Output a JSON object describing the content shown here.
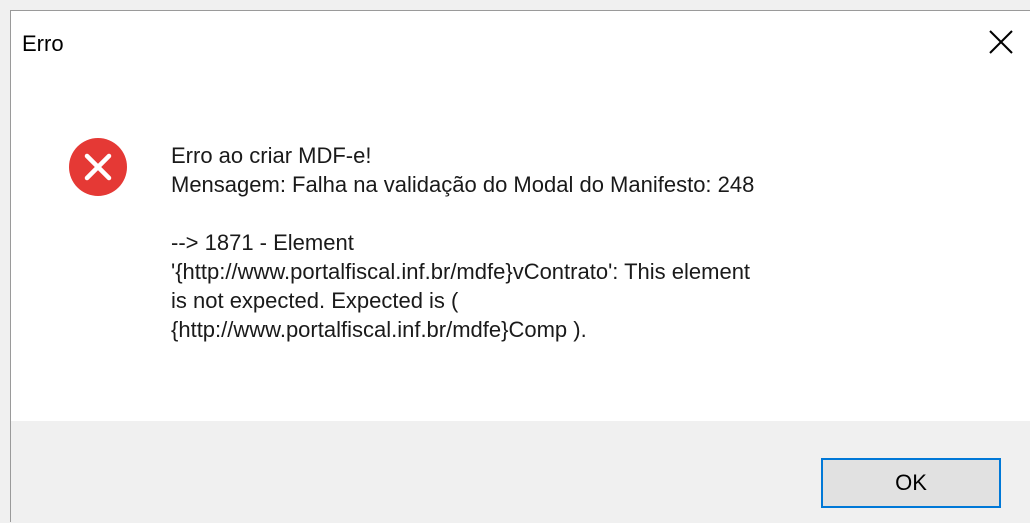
{
  "window": {
    "title": "Erro",
    "close_icon": "close-icon"
  },
  "icon": {
    "name": "error-icon",
    "color": "#e53935"
  },
  "message": {
    "line1": "Erro ao criar MDF-e!",
    "line2": "Mensagem: Falha na validação do Modal do Manifesto: 248",
    "line3": " --> 1871 - Element",
    "line4": "'{http://www.portalfiscal.inf.br/mdfe}vContrato': This element",
    "line5": "is not expected. Expected is (",
    "line6": "{http://www.portalfiscal.inf.br/mdfe}Comp )."
  },
  "buttons": {
    "ok_label": "OK"
  },
  "colors": {
    "accent": "#0078d7",
    "footer_bg": "#f0f0f0",
    "button_bg": "#e1e1e1"
  }
}
